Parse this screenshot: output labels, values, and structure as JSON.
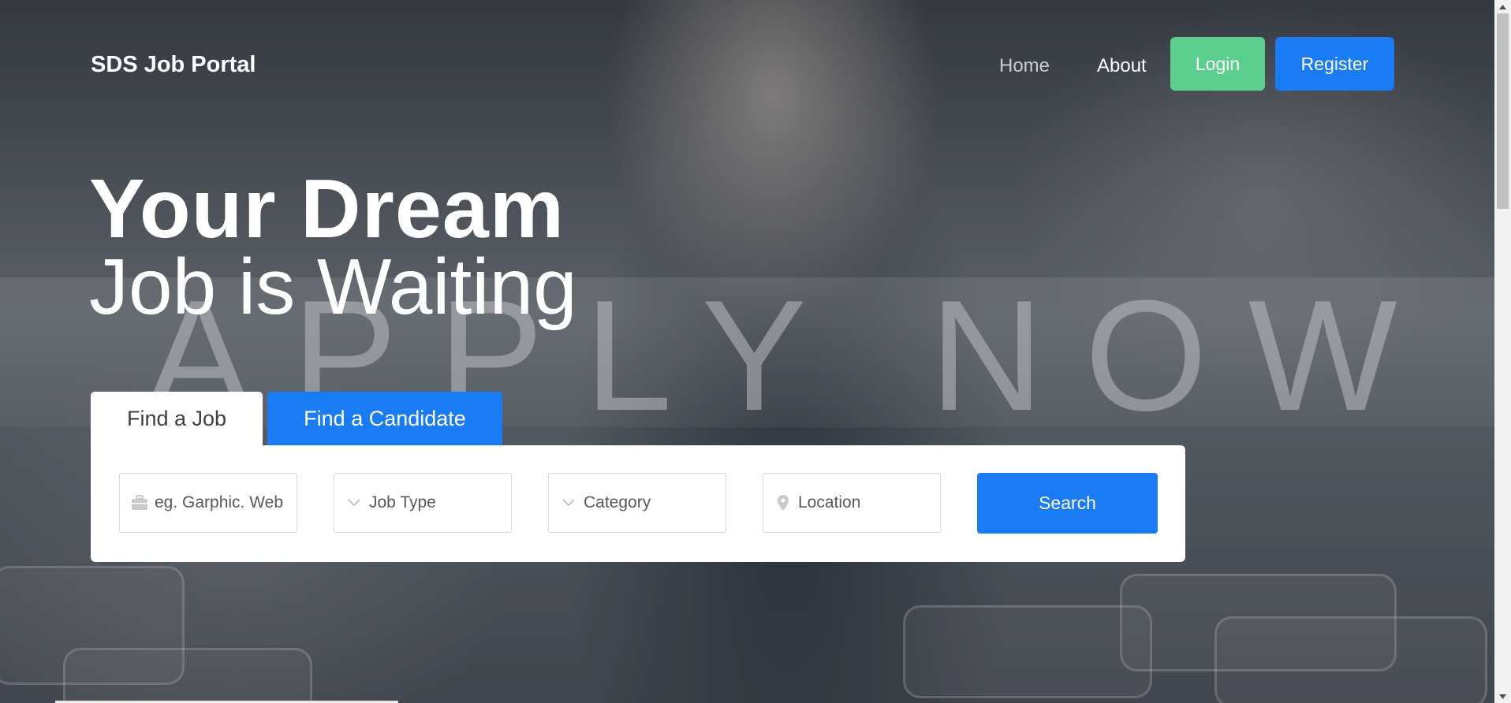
{
  "navbar": {
    "brand": "SDS Job Portal",
    "links": {
      "home": "Home",
      "about": "About"
    },
    "login_label": "Login",
    "register_label": "Register"
  },
  "hero": {
    "headline_line1": "Your Dream",
    "headline_line2": "Job is Waiting",
    "background_text": "APPLY NOW"
  },
  "tabs": {
    "find_job": "Find a Job",
    "find_candidate": "Find a Candidate",
    "active": "Find a Job"
  },
  "search": {
    "keyword_placeholder": "eg. Garphic. Web",
    "job_type_label": "Job Type",
    "category_label": "Category",
    "location_placeholder": "Location",
    "button_label": "Search"
  },
  "icons": {
    "keyword": "briefcase-icon",
    "job_type": "chevron-down-icon",
    "category": "chevron-down-icon",
    "location": "map-pin-icon"
  },
  "colors": {
    "primary": "#1a7cf5",
    "login": "#5acf8e",
    "home_link": "#c9cbcf"
  }
}
